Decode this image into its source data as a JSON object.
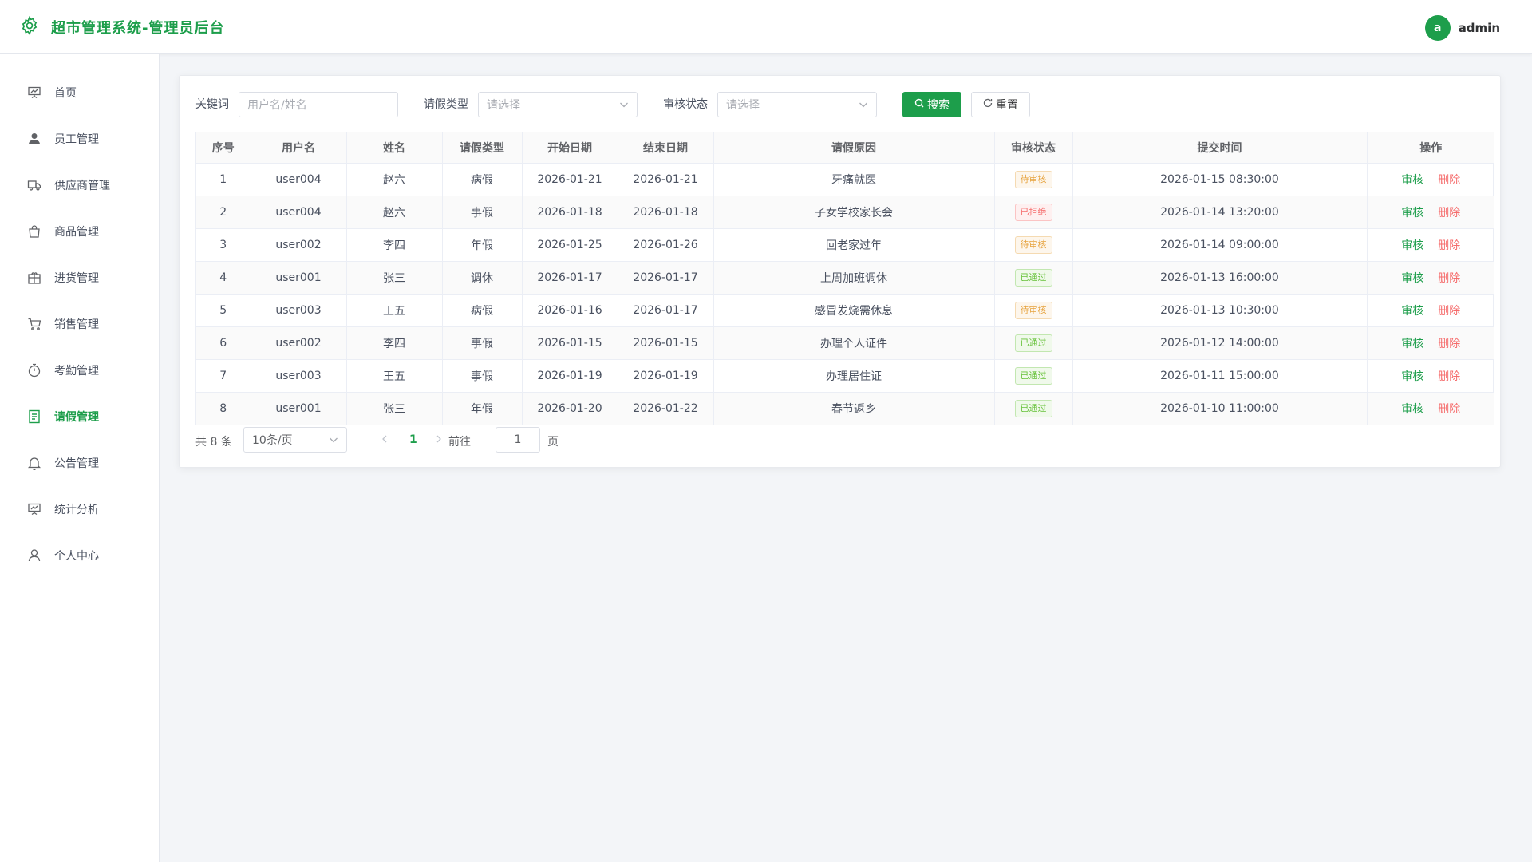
{
  "header": {
    "title": "超市管理系统-管理员后台",
    "avatar_letter": "a",
    "username": "admin",
    "accent": "#1d9e4b"
  },
  "sidebar": {
    "items": [
      {
        "label": "首页",
        "icon": "dashboard-icon"
      },
      {
        "label": "员工管理",
        "icon": "user-icon"
      },
      {
        "label": "供应商管理",
        "icon": "truck-icon"
      },
      {
        "label": "商品管理",
        "icon": "shopping-bag-icon"
      },
      {
        "label": "进货管理",
        "icon": "box-icon"
      },
      {
        "label": "销售管理",
        "icon": "cart-icon"
      },
      {
        "label": "考勤管理",
        "icon": "stopwatch-icon"
      },
      {
        "label": "请假管理",
        "icon": "document-icon"
      },
      {
        "label": "公告管理",
        "icon": "bell-icon"
      },
      {
        "label": "统计分析",
        "icon": "chart-board-icon"
      },
      {
        "label": "个人中心",
        "icon": "user-outline-icon"
      }
    ],
    "active": "请假管理"
  },
  "filters": {
    "keyword_label": "关键词",
    "keyword_placeholder": "用户名/姓名",
    "type_label": "请假类型",
    "type_placeholder": "请选择",
    "status_label": "审核状态",
    "status_placeholder": "请选择",
    "search_label": "搜索",
    "reset_label": "重置"
  },
  "table": {
    "columns": [
      "序号",
      "用户名",
      "姓名",
      "请假类型",
      "开始日期",
      "结束日期",
      "请假原因",
      "审核状态",
      "提交时间",
      "操作"
    ],
    "rows": [
      {
        "no": "1",
        "username": "user004",
        "name": "赵六",
        "type": "病假",
        "start": "2026-01-21",
        "end": "2026-01-21",
        "reason": "牙痛就医",
        "status": "待审核",
        "status_kind": "pending",
        "submitted": "2026-01-15 08:30:00"
      },
      {
        "no": "2",
        "username": "user004",
        "name": "赵六",
        "type": "事假",
        "start": "2026-01-18",
        "end": "2026-01-18",
        "reason": "子女学校家长会",
        "status": "已拒绝",
        "status_kind": "rejected",
        "submitted": "2026-01-14 13:20:00"
      },
      {
        "no": "3",
        "username": "user002",
        "name": "李四",
        "type": "年假",
        "start": "2026-01-25",
        "end": "2026-01-26",
        "reason": "回老家过年",
        "status": "待审核",
        "status_kind": "pending",
        "submitted": "2026-01-14 09:00:00"
      },
      {
        "no": "4",
        "username": "user001",
        "name": "张三",
        "type": "调休",
        "start": "2026-01-17",
        "end": "2026-01-17",
        "reason": "上周加班调休",
        "status": "已通过",
        "status_kind": "approved",
        "submitted": "2026-01-13 16:00:00"
      },
      {
        "no": "5",
        "username": "user003",
        "name": "王五",
        "type": "病假",
        "start": "2026-01-16",
        "end": "2026-01-17",
        "reason": "感冒发烧需休息",
        "status": "待审核",
        "status_kind": "pending",
        "submitted": "2026-01-13 10:30:00"
      },
      {
        "no": "6",
        "username": "user002",
        "name": "李四",
        "type": "事假",
        "start": "2026-01-15",
        "end": "2026-01-15",
        "reason": "办理个人证件",
        "status": "已通过",
        "status_kind": "approved",
        "submitted": "2026-01-12 14:00:00"
      },
      {
        "no": "7",
        "username": "user003",
        "name": "王五",
        "type": "事假",
        "start": "2026-01-19",
        "end": "2026-01-19",
        "reason": "办理居住证",
        "status": "已通过",
        "status_kind": "approved",
        "submitted": "2026-01-11 15:00:00"
      },
      {
        "no": "8",
        "username": "user001",
        "name": "张三",
        "type": "年假",
        "start": "2026-01-20",
        "end": "2026-01-22",
        "reason": "春节返乡",
        "status": "已通过",
        "status_kind": "approved",
        "submitted": "2026-01-10 11:00:00"
      }
    ],
    "action_review": "审核",
    "action_delete": "删除"
  },
  "pagination": {
    "total_text": "共 8 条",
    "page_size": "10条/页",
    "current_page": "1",
    "goto_label": "前往",
    "goto_value": "1",
    "page_unit": "页"
  }
}
